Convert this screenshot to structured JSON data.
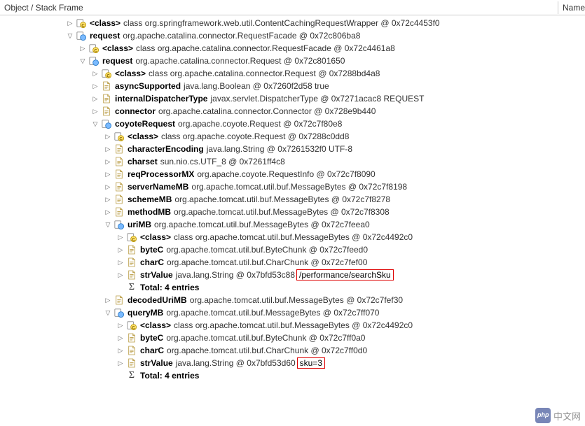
{
  "header": {
    "col1": "Object / Stack Frame",
    "col2": "Name"
  },
  "rows": [
    {
      "indent": 5,
      "toggle": ">",
      "icon": "class",
      "name": "<class>",
      "val": "class org.springframework.web.util.ContentCachingRequestWrapper @ 0x72c4453f0"
    },
    {
      "indent": 5,
      "toggle": "v",
      "icon": "obj",
      "name": "request",
      "val": "org.apache.catalina.connector.RequestFacade @ 0x72c806ba8"
    },
    {
      "indent": 6,
      "toggle": ">",
      "icon": "class",
      "name": "<class>",
      "val": "class org.apache.catalina.connector.RequestFacade @ 0x72c4461a8"
    },
    {
      "indent": 6,
      "toggle": "v",
      "icon": "obj",
      "name": "request",
      "val": "org.apache.catalina.connector.Request @ 0x72c801650"
    },
    {
      "indent": 7,
      "toggle": ">",
      "icon": "class",
      "name": "<class>",
      "val": "class org.apache.catalina.connector.Request @ 0x7288bd4a8"
    },
    {
      "indent": 7,
      "toggle": ">",
      "icon": "file",
      "name": "asyncSupported",
      "val": "java.lang.Boolean @ 0x7260f2d58  true"
    },
    {
      "indent": 7,
      "toggle": ">",
      "icon": "file",
      "name": "internalDispatcherType",
      "val": "javax.servlet.DispatcherType @ 0x7271acac8  REQUEST"
    },
    {
      "indent": 7,
      "toggle": ">",
      "icon": "file",
      "name": "connector",
      "val": "org.apache.catalina.connector.Connector @ 0x728e9b440"
    },
    {
      "indent": 7,
      "toggle": "v",
      "icon": "obj",
      "name": "coyoteRequest",
      "val": "org.apache.coyote.Request @ 0x72c7f80e8"
    },
    {
      "indent": 8,
      "toggle": ">",
      "icon": "class",
      "name": "<class>",
      "val": "class org.apache.coyote.Request @ 0x7288c0dd8"
    },
    {
      "indent": 8,
      "toggle": ">",
      "icon": "file",
      "name": "characterEncoding",
      "val": "java.lang.String @ 0x7261532f0  UTF-8"
    },
    {
      "indent": 8,
      "toggle": ">",
      "icon": "file",
      "name": "charset",
      "val": "sun.nio.cs.UTF_8 @ 0x7261ff4c8"
    },
    {
      "indent": 8,
      "toggle": ">",
      "icon": "file",
      "name": "reqProcessorMX",
      "val": "org.apache.coyote.RequestInfo @ 0x72c7f8090"
    },
    {
      "indent": 8,
      "toggle": ">",
      "icon": "file",
      "name": "serverNameMB",
      "val": "org.apache.tomcat.util.buf.MessageBytes @ 0x72c7f8198"
    },
    {
      "indent": 8,
      "toggle": ">",
      "icon": "file",
      "name": "schemeMB",
      "val": "org.apache.tomcat.util.buf.MessageBytes @ 0x72c7f8278"
    },
    {
      "indent": 8,
      "toggle": ">",
      "icon": "file",
      "name": "methodMB",
      "val": "org.apache.tomcat.util.buf.MessageBytes @ 0x72c7f8308"
    },
    {
      "indent": 8,
      "toggle": "v",
      "icon": "obj",
      "name": "uriMB",
      "val": "org.apache.tomcat.util.buf.MessageBytes @ 0x72c7feea0"
    },
    {
      "indent": 9,
      "toggle": ">",
      "icon": "class",
      "name": "<class>",
      "val": "class org.apache.tomcat.util.buf.MessageBytes @ 0x72c4492c0"
    },
    {
      "indent": 9,
      "toggle": ">",
      "icon": "file",
      "name": "byteC",
      "val": "org.apache.tomcat.util.buf.ByteChunk @ 0x72c7feed0"
    },
    {
      "indent": 9,
      "toggle": ">",
      "icon": "file",
      "name": "charC",
      "val": "org.apache.tomcat.util.buf.CharChunk @ 0x72c7fef00"
    },
    {
      "indent": 9,
      "toggle": ">",
      "icon": "file",
      "name": "strValue",
      "val": "java.lang.String @ 0x7bfd53c88",
      "hl": "/performance/searchSku"
    },
    {
      "indent": 9,
      "toggle": "",
      "icon": "sigma",
      "name": "Total: 4 entries",
      "val": ""
    },
    {
      "indent": 8,
      "toggle": ">",
      "icon": "file",
      "name": "decodedUriMB",
      "val": "org.apache.tomcat.util.buf.MessageBytes @ 0x72c7fef30"
    },
    {
      "indent": 8,
      "toggle": "v",
      "icon": "obj",
      "name": "queryMB",
      "val": "org.apache.tomcat.util.buf.MessageBytes @ 0x72c7ff070"
    },
    {
      "indent": 9,
      "toggle": ">",
      "icon": "class",
      "name": "<class>",
      "val": "class org.apache.tomcat.util.buf.MessageBytes @ 0x72c4492c0"
    },
    {
      "indent": 9,
      "toggle": ">",
      "icon": "file",
      "name": "byteC",
      "val": "org.apache.tomcat.util.buf.ByteChunk @ 0x72c7ff0a0"
    },
    {
      "indent": 9,
      "toggle": ">",
      "icon": "file",
      "name": "charC",
      "val": "org.apache.tomcat.util.buf.CharChunk @ 0x72c7ff0d0"
    },
    {
      "indent": 9,
      "toggle": ">",
      "icon": "file",
      "name": "strValue",
      "val": "java.lang.String @ 0x7bfd53d60",
      "hl": "sku=3"
    },
    {
      "indent": 9,
      "toggle": "",
      "icon": "sigma",
      "name": "Total: 4 entries",
      "val": ""
    }
  ],
  "watermark": "中文网"
}
